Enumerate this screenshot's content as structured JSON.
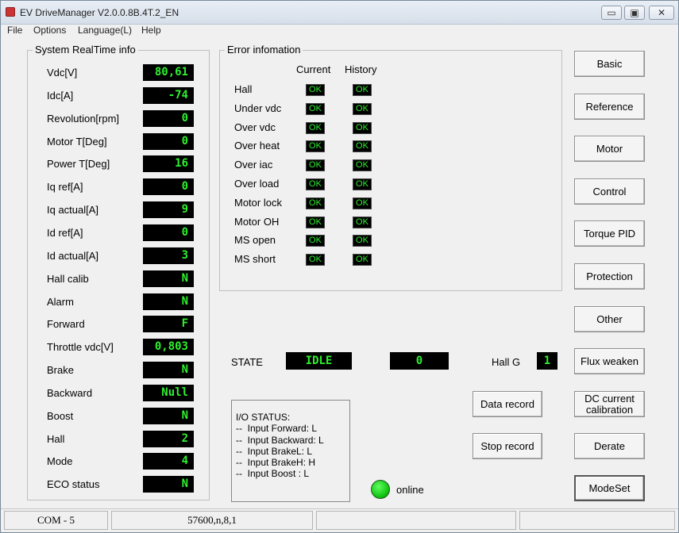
{
  "window": {
    "title": "EV DriveManager V2.0.0.8B.4T.2_EN",
    "controls": {
      "minimize": "▭",
      "maximize": "▣",
      "close": "✕"
    }
  },
  "menu": [
    "File",
    "Options",
    "Language(L)",
    "Help"
  ],
  "realtime": {
    "title": "System RealTime info",
    "rows": [
      {
        "label": "Vdc[V]",
        "value": "80,61"
      },
      {
        "label": "Idc[A]",
        "value": "-74"
      },
      {
        "label": "Revolution[rpm]",
        "value": "0"
      },
      {
        "label": "Motor T[Deg]",
        "value": "0"
      },
      {
        "label": "Power T[Deg]",
        "value": "16"
      },
      {
        "label": "Iq ref[A]",
        "value": "0"
      },
      {
        "label": "Iq actual[A]",
        "value": "9"
      },
      {
        "label": "Id ref[A]",
        "value": "0"
      },
      {
        "label": "Id actual[A]",
        "value": "3"
      },
      {
        "label": "Hall calib",
        "value": "N"
      },
      {
        "label": "Alarm",
        "value": "N"
      },
      {
        "label": "Forward",
        "value": "F"
      },
      {
        "label": "Throttle vdc[V]",
        "value": "0,803"
      },
      {
        "label": "Brake",
        "value": "N"
      },
      {
        "label": "Backward",
        "value": "Null"
      },
      {
        "label": "Boost",
        "value": "N"
      },
      {
        "label": "Hall",
        "value": "2"
      },
      {
        "label": "Mode",
        "value": "4"
      },
      {
        "label": "ECO status",
        "value": "N"
      }
    ]
  },
  "errors": {
    "title": "Error infomation",
    "current_header": "Current",
    "history_header": "History",
    "rows": [
      {
        "label": "Hall",
        "current": "OK",
        "history": "OK"
      },
      {
        "label": "Under vdc",
        "current": "OK",
        "history": "OK"
      },
      {
        "label": "Over vdc",
        "current": "OK",
        "history": "OK"
      },
      {
        "label": "Over heat",
        "current": "OK",
        "history": "OK"
      },
      {
        "label": "Over iac",
        "current": "OK",
        "history": "OK"
      },
      {
        "label": "Over load",
        "current": "OK",
        "history": "OK"
      },
      {
        "label": "Motor lock",
        "current": "OK",
        "history": "OK"
      },
      {
        "label": "Motor OH",
        "current": "OK",
        "history": "OK"
      },
      {
        "label": "MS open",
        "current": "OK",
        "history": "OK"
      },
      {
        "label": "MS short",
        "current": "OK",
        "history": "OK"
      }
    ]
  },
  "state": {
    "label": "STATE",
    "value": "IDLE",
    "code": "0",
    "hall_g_label": "Hall G",
    "hall_g_value": "1"
  },
  "io_status": {
    "lines": [
      "I/O STATUS:",
      "--  Input Forward: L",
      "--  Input Backward: L",
      "--  Input BrakeL: L",
      "--  Input BrakeH: H",
      "--  Input Boost : L"
    ]
  },
  "record": {
    "data_record": "Data record",
    "stop_record": "Stop record"
  },
  "online": {
    "label": "online",
    "color": "#12c212"
  },
  "side_buttons": {
    "basic": "Basic",
    "reference": "Reference",
    "motor": "Motor",
    "control": "Control",
    "torque_pid": "Torque PID",
    "protection": "Protection",
    "other": "Other",
    "flux_weaken": "Flux weaken",
    "dc_current_line1": "DC current",
    "dc_current_line2": "calibration",
    "derate": "Derate",
    "modeset": "ModeSet"
  },
  "statusbar": {
    "port": "COM - 5",
    "settings": "57600,n,8,1",
    "cell3": "",
    "cell4": ""
  },
  "colors": {
    "lcd_text": "#2eef2e",
    "lcd_bg": "#000000",
    "window_bg": "#f0f0f0"
  }
}
